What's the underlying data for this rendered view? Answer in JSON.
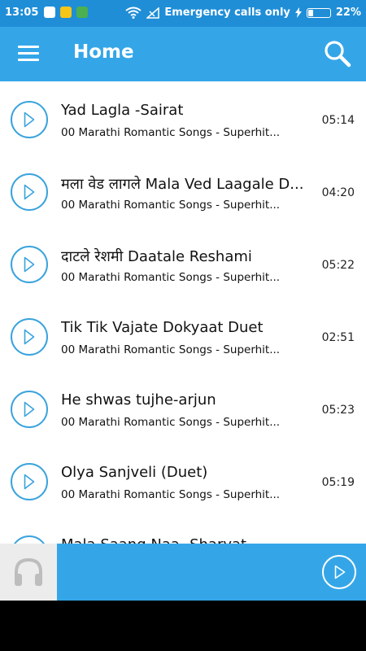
{
  "status_bar": {
    "time": "13:05",
    "carrier_text": "Emergency calls only",
    "battery": "22%",
    "battery_level": 0.22
  },
  "app_bar": {
    "title": "Home",
    "menu_icon": "hamburger-menu-icon",
    "search_icon": "search-icon"
  },
  "songs": [
    {
      "title": "Yad Lagla -Sairat",
      "subtitle": "00 Marathi Romantic Songs - Superhit...",
      "duration": "05:14"
    },
    {
      "title": "मला वेड लागले Mala Ved Laagale D...",
      "subtitle": "00 Marathi Romantic Songs - Superhit...",
      "duration": "04:20"
    },
    {
      "title": "दाटले रेशमी Daatale Reshami",
      "subtitle": "00 Marathi Romantic Songs - Superhit...",
      "duration": "05:22"
    },
    {
      "title": "Tik Tik Vajate Dokyaat Duet",
      "subtitle": "00 Marathi Romantic Songs - Superhit...",
      "duration": "02:51"
    },
    {
      "title": "He shwas tujhe-arjun",
      "subtitle": "00 Marathi Romantic Songs - Superhit...",
      "duration": "05:23"
    },
    {
      "title": " Olya Sanjveli (Duet)",
      "subtitle": "00 Marathi Romantic Songs - Superhit...",
      "duration": "05:19"
    },
    {
      "title": "Mala Saang Naa- Sharyat",
      "subtitle": "",
      "duration": ""
    }
  ],
  "player": {
    "art_icon": "headphones-icon",
    "play_icon": "play-icon"
  },
  "colors": {
    "status_bar": "#1f8ed7",
    "app_bar": "#34a6e8",
    "accent": "#3aa3dd"
  }
}
